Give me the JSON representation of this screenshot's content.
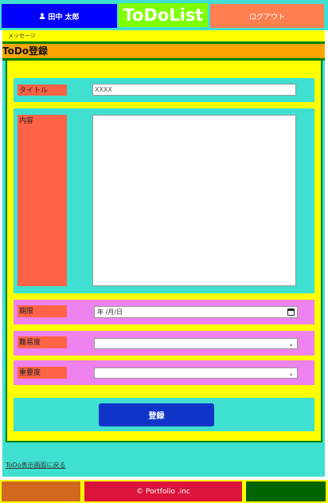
{
  "header": {
    "user_name": "田中 太郎",
    "logo": "ToDoList",
    "logout_label": "ログアウト"
  },
  "message": "メッセージ",
  "page_title": "ToDo登録",
  "form": {
    "title_label": "タイトル",
    "title_placeholder": "XXXX",
    "content_label": "内容",
    "deadline_label": "期限",
    "deadline_placeholder": "年 /月/日",
    "difficulty_label": "難易度",
    "difficulty_value": "",
    "priority_label": "重要度",
    "priority_value": "",
    "submit_label": "登録"
  },
  "back_link": "ToDo表示画面に戻る",
  "footer": {
    "copyright": "© Portfolio .inc"
  },
  "colors": {
    "header_bg": "#40e0d0",
    "user_btn": "#0000ff",
    "logo_bg": "#7fff00",
    "logout_btn": "#ff7f50",
    "message_bg": "#ffff00",
    "title_bg": "#ffa500",
    "label_bg": "#ff6347",
    "submit_btn": "#0e34c8",
    "footer_left": "#d2691e",
    "footer_mid": "#dc143c",
    "footer_right": "#006400"
  }
}
